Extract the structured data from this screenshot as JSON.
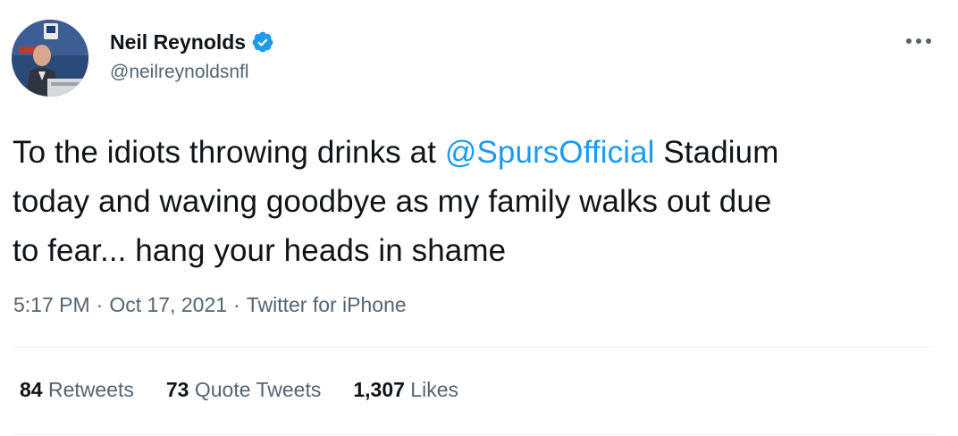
{
  "author": {
    "display_name": "Neil Reynolds",
    "handle": "@neilreynoldsnfl",
    "verified": true,
    "avatar_icon": "profile-photo"
  },
  "tweet": {
    "text_before": "To the idiots throwing drinks at ",
    "mention": "@SpursOfficial",
    "text_line1_after": " Stadium",
    "text_line2": "today and waving goodbye as my family walks out due",
    "text_line3": "to fear... hang your heads in shame"
  },
  "meta": {
    "time": "5:17 PM",
    "sep1": "·",
    "date": "Oct 17, 2021",
    "sep2": "·",
    "source": "Twitter for iPhone"
  },
  "stats": {
    "retweets_count": "84",
    "retweets_label": "Retweets",
    "quotes_count": "73",
    "quotes_label": "Quote Tweets",
    "likes_count": "1,307",
    "likes_label": "Likes"
  },
  "colors": {
    "accent": "#1d9bf0",
    "text": "#0f1419",
    "secondary": "#536471",
    "divider": "#eff3f4"
  }
}
